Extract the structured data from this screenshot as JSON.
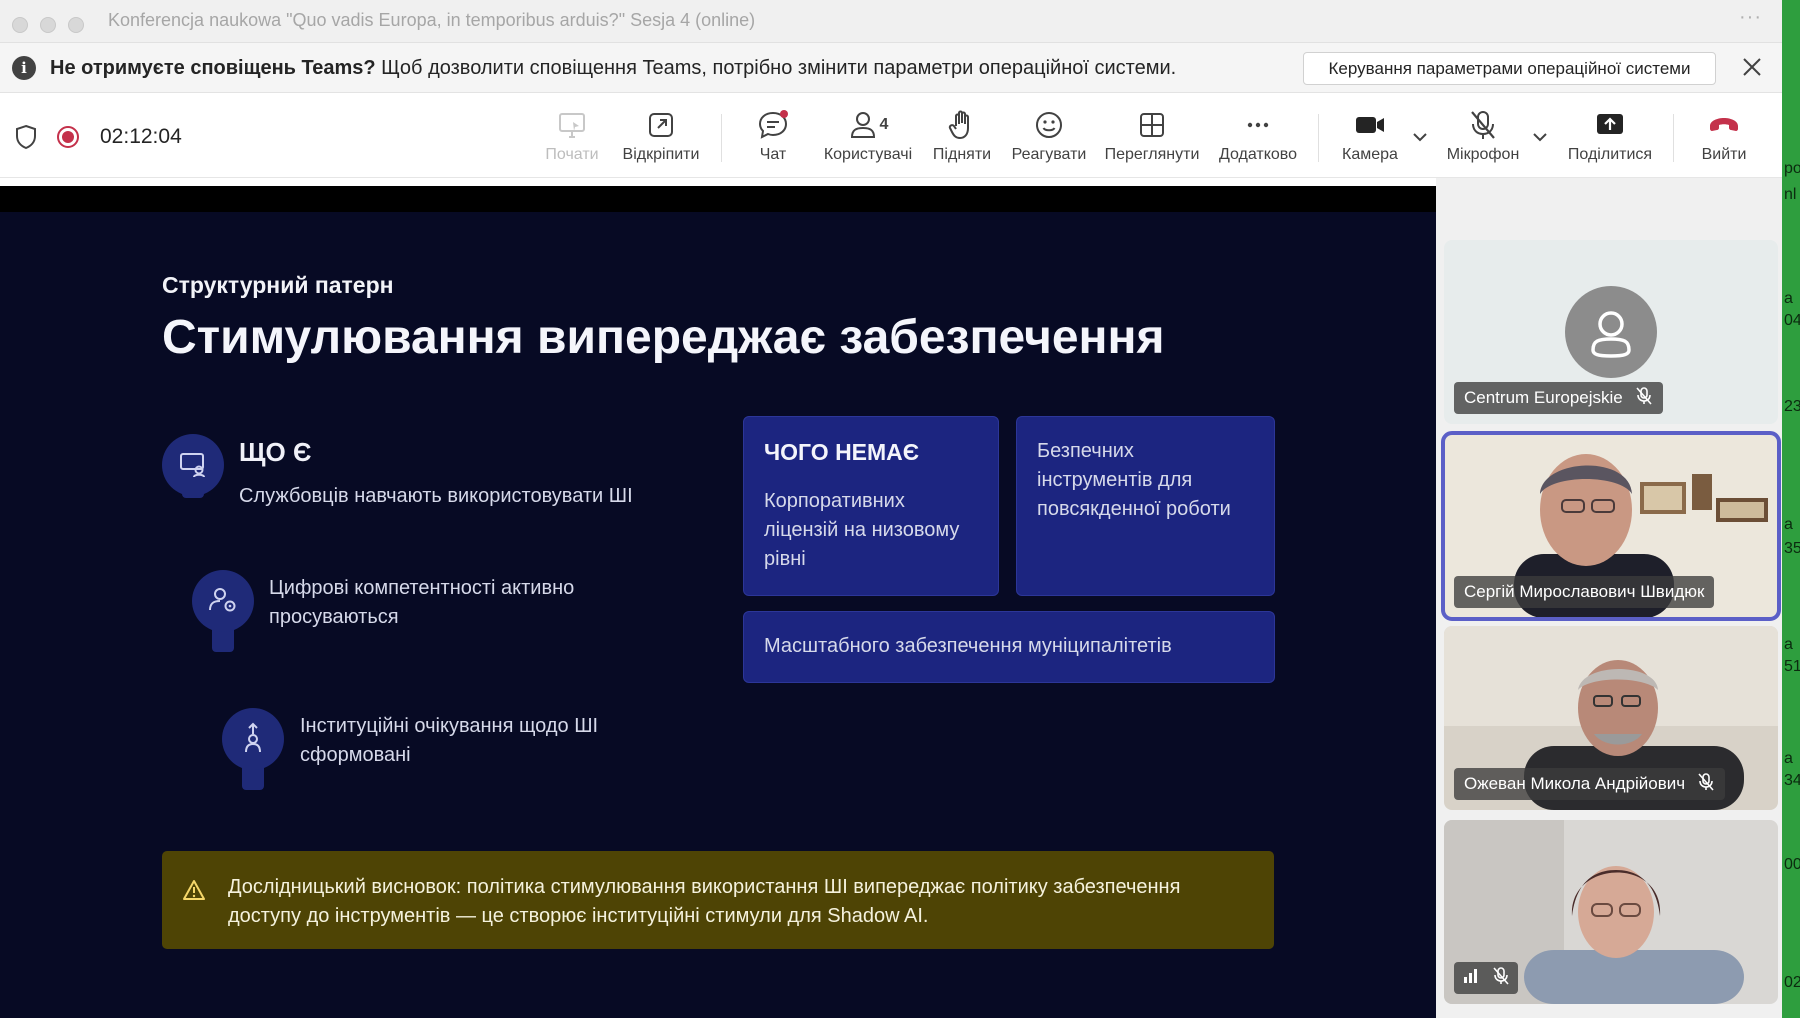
{
  "window": {
    "title": "Konferencja naukowa \"Quo vadis Europa, in temporibus arduis?\" Sesja 4 (online)",
    "more": "···"
  },
  "notification": {
    "bold": "Не отримуєте сповіщень Teams?",
    "text": " Щоб дозволити сповіщення Teams, потрібно змінити параметри операційної системи.",
    "button": "Керування параметрами операційної системи"
  },
  "toolbar": {
    "timer": "02:12:04",
    "items": {
      "start": "Почати",
      "popout": "Відкріпити",
      "chat": "Чат",
      "people": "Користувачі",
      "people_count": "4",
      "raise": "Підняти",
      "react": "Реагувати",
      "view": "Переглянути",
      "more": "Додатково",
      "camera": "Камера",
      "mic": "Мікрофон",
      "share": "Поділитися",
      "leave": "Вийти"
    }
  },
  "slide": {
    "kicker": "Структурний патерн",
    "title": "Стимулювання випереджає забезпечення",
    "what_is": {
      "heading": "ЩО Є",
      "items": [
        "Службовців навчають використовувати ШІ",
        "Цифрові компетентності активно просуваються",
        "Інституційні очікування щодо ШІ сформовані"
      ]
    },
    "what_missing": {
      "heading": "ЧОГО НЕМАЄ",
      "items": [
        "Корпоративних ліцензій на низовому рівні",
        "Безпечних інструментів для повсякденної роботи",
        "Масштабного забезпечення муніципалітетів"
      ]
    },
    "callout": "Дослідницький висновок: політика стимулювання використання ШІ випереджає політику забезпечення доступу до інструментів — це створює інституційні стимули для Shadow AI."
  },
  "participants": [
    {
      "name": "Centrum Europejskie",
      "muted": true
    },
    {
      "name": "Сергій Мирославович Швидюк",
      "muted": false,
      "active": true
    },
    {
      "name": "Ожеван Микола Андрійович",
      "muted": true
    },
    {
      "name": "",
      "muted": true
    }
  ],
  "background_edge_text": [
    "po",
    "nl",
    "a",
    "04",
    "23",
    "a",
    "35",
    "a",
    "51",
    "a",
    "34",
    "00",
    "02"
  ]
}
